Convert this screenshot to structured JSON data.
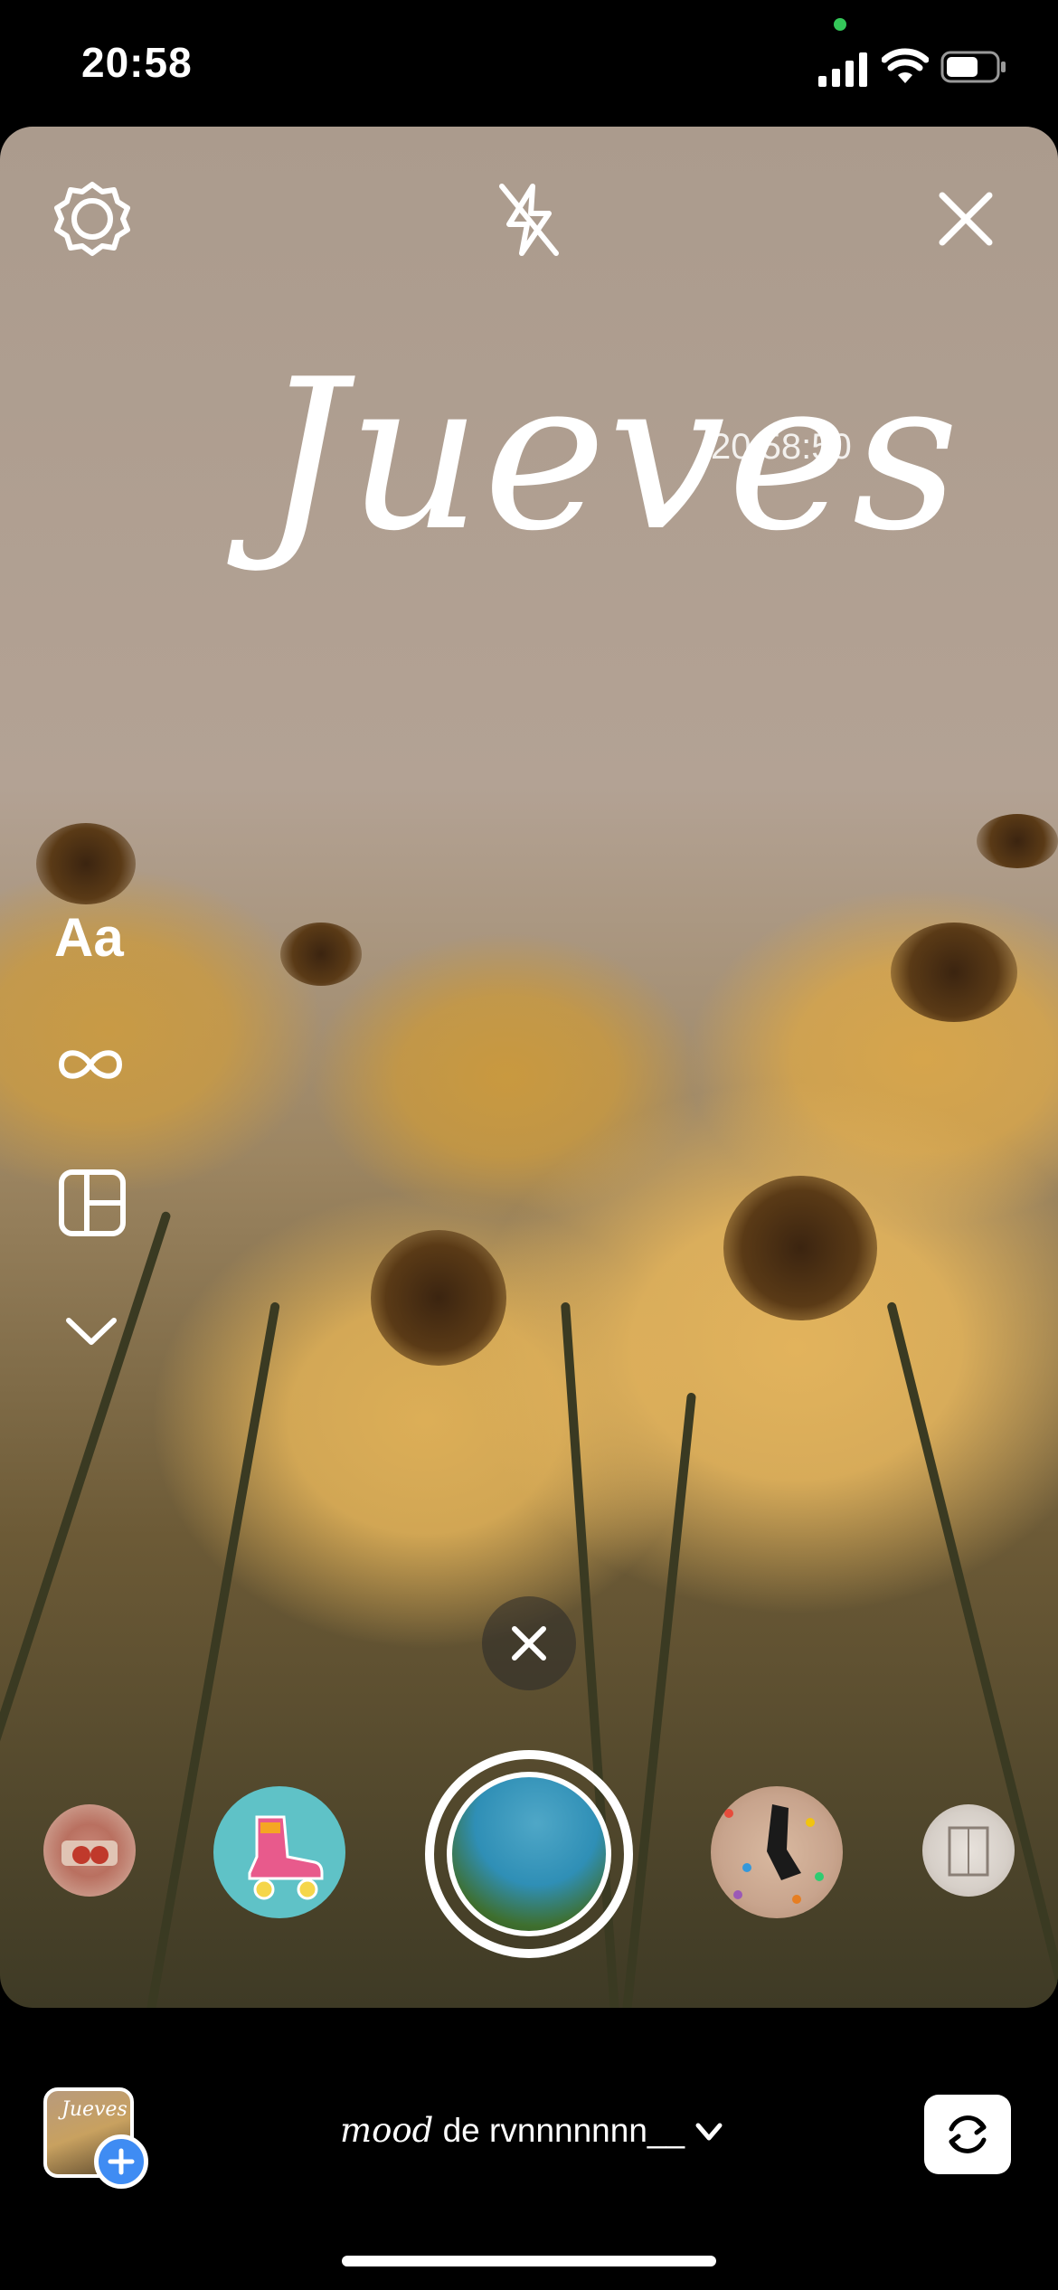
{
  "status_bar": {
    "time": "20:58"
  },
  "overlay": {
    "day_text": "Jueves",
    "time_text": "20:58:50"
  },
  "left_tools": {
    "text_tool_label": "Aa"
  },
  "bottom_bar": {
    "mood_word": "mood",
    "mood_rest": " de rvnnnnnnn__"
  },
  "icons": {
    "settings": "gear-icon",
    "flash": "flash-off-icon",
    "close": "close-icon",
    "boomerang": "infinity-icon",
    "layout": "layout-icon",
    "more": "chevron-down-icon",
    "cancel": "close-icon",
    "flip": "flip-camera-icon"
  },
  "colors": {
    "add_badge": "#3f8cf3",
    "recording_dot": "#34c759"
  }
}
